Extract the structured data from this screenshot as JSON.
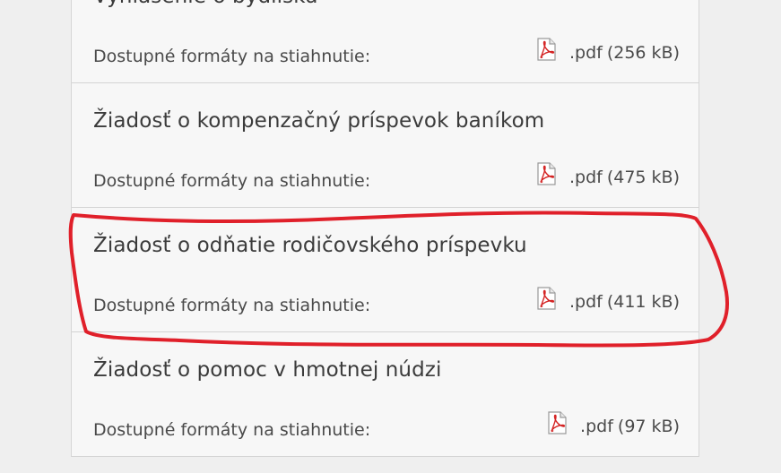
{
  "downloads": {
    "items": [
      {
        "title": "Vyhlásenie o bydlisku",
        "formats_label": "Dostupné formáty na stiahnutie:",
        "format": ".pdf",
        "size": "(256 kB)"
      },
      {
        "title": "Žiadosť o kompenzačný príspevok baníkom",
        "formats_label": "Dostupné formáty na stiahnutie:",
        "format": ".pdf",
        "size": "(475 kB)"
      },
      {
        "title": "Žiadosť o odňatie rodičovského príspevku",
        "formats_label": "Dostupné formáty na stiahnutie:",
        "format": ".pdf",
        "size": "(411 kB)"
      },
      {
        "title": "Žiadosť o pomoc v hmotnej núdzi",
        "formats_label": "Dostupné formáty na stiahnutie:",
        "format": ".pdf",
        "size": "(97 kB)"
      }
    ],
    "icon": "pdf-file-icon",
    "annotation_color": "#e0202a"
  }
}
